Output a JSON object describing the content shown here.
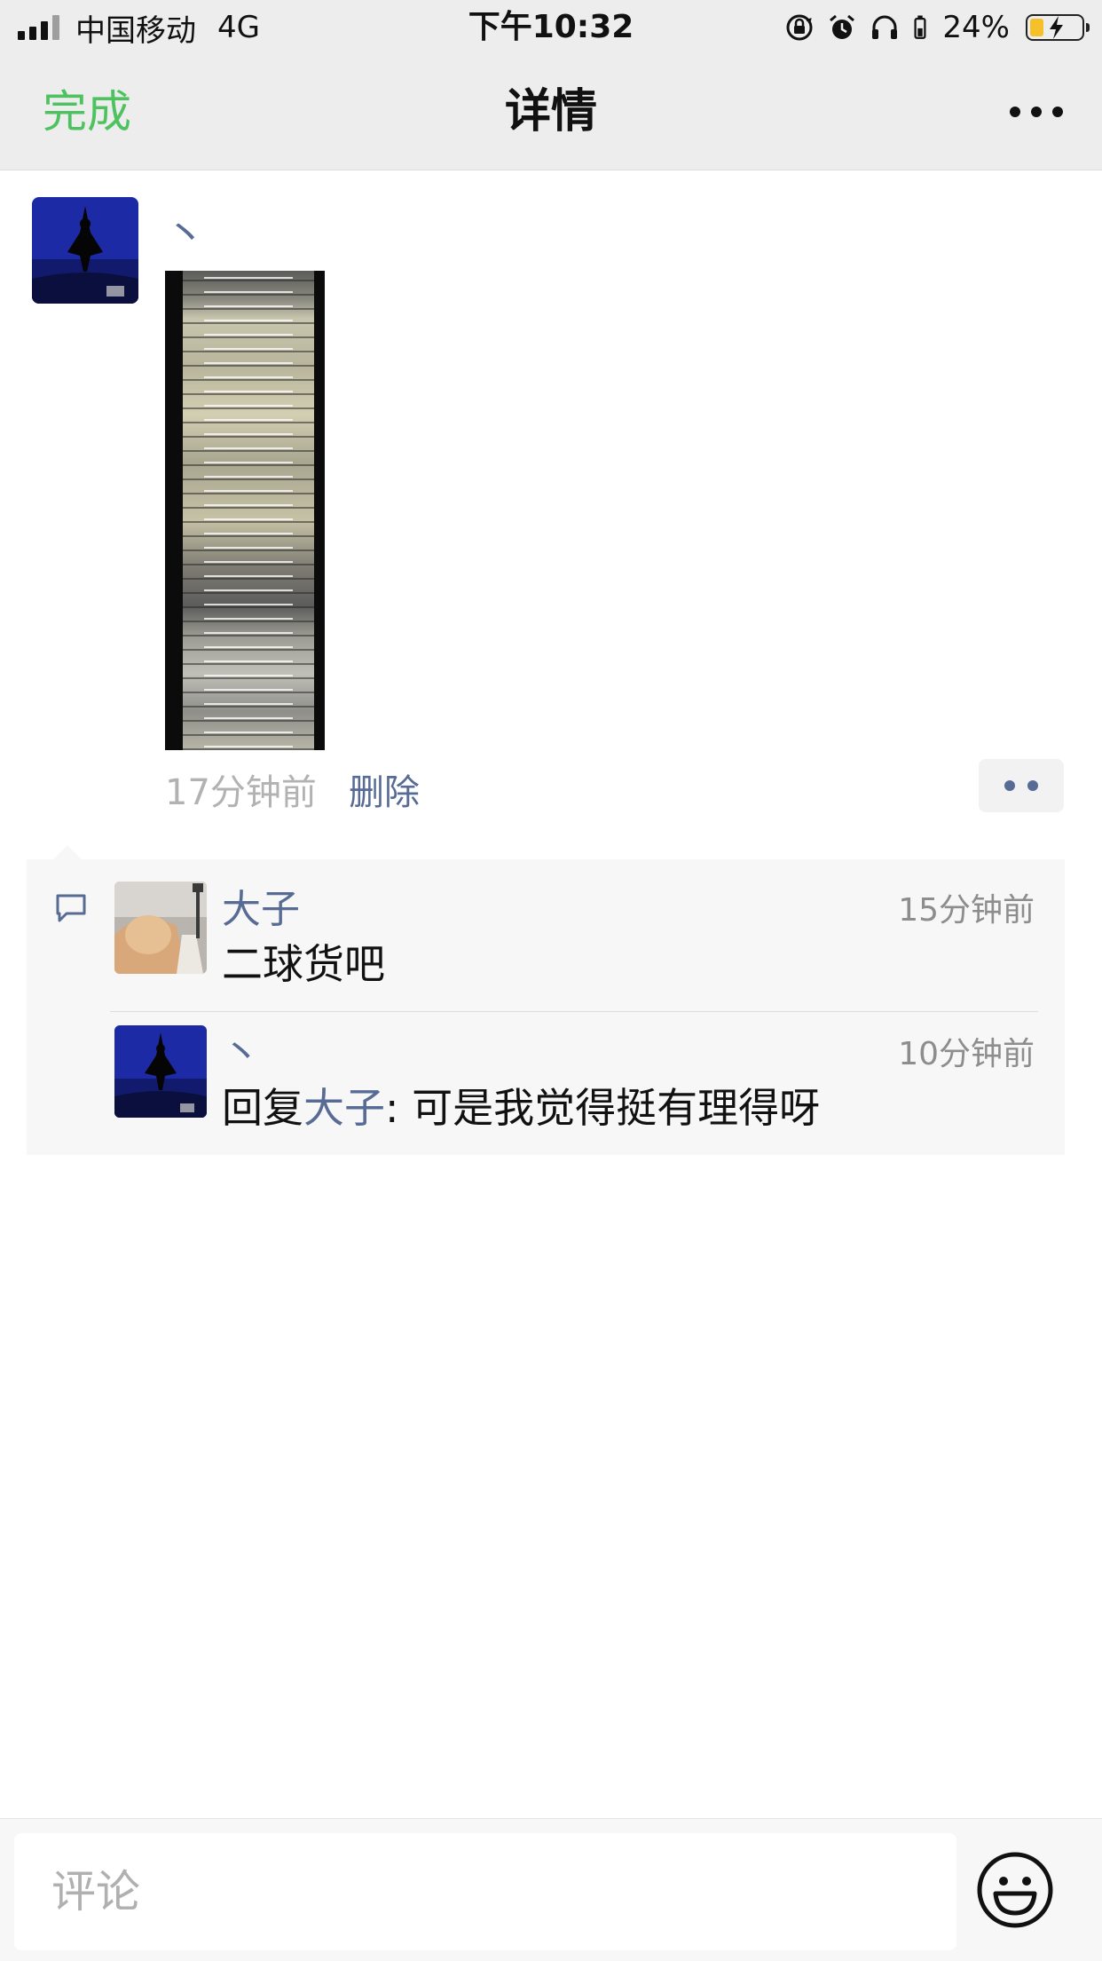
{
  "status_bar": {
    "carrier": "中国移动",
    "network": "4G",
    "time": "下午10:32",
    "battery_percent": "24%",
    "battery_level": 0.24,
    "icons": [
      "signal-icon",
      "rotation-lock-icon",
      "alarm-icon",
      "headphones-icon",
      "battery-icon"
    ]
  },
  "nav": {
    "done_label": "完成",
    "title": "详情",
    "more_icon": "more-icon"
  },
  "post": {
    "author": "丶",
    "time": "17分钟前",
    "delete_label": "删除",
    "action_icon": "like-comment-menu-icon"
  },
  "comments": [
    {
      "author": "大子",
      "time": "15分钟前",
      "text": "二球货吧"
    },
    {
      "author": "丶",
      "time": "10分钟前",
      "reply_prefix": "回复",
      "reply_to": "大子",
      "reply_sep": ": ",
      "text": "可是我觉得挺有理得呀"
    }
  ],
  "composer": {
    "placeholder": "评论",
    "emoji_icon": "emoji-icon"
  },
  "colors": {
    "accent_green": "#4ec25f",
    "link_blue": "#576b95",
    "bar_bg": "#ededed"
  }
}
